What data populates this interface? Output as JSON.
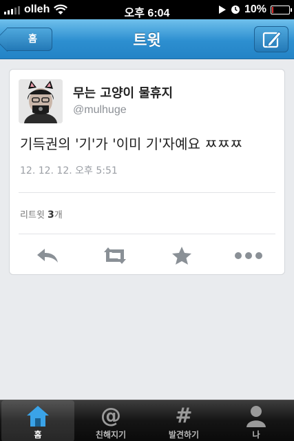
{
  "status_bar": {
    "carrier": "olleh",
    "time": "오후 6:04",
    "battery": "10%",
    "battery_level": 0.1,
    "battery_color": "#e33333"
  },
  "nav": {
    "title": "트윗",
    "back_label": "홈",
    "compose_icon": "compose-icon"
  },
  "tweet": {
    "display_name": "무는 고양이 물휴지",
    "handle": "@mulhuge",
    "text": "기득권의 '기'가 '이미 기'자예요 ㅉㅉㅉ",
    "timestamp": "12. 12. 12. 오후 5:51",
    "retweet_prefix": "리트윗 ",
    "retweet_count": "3",
    "retweet_suffix": "개"
  },
  "actions": [
    {
      "name": "reply-icon"
    },
    {
      "name": "retweet-icon"
    },
    {
      "name": "favorite-star-icon"
    },
    {
      "name": "more-icon"
    }
  ],
  "tabs": [
    {
      "label": "홈",
      "icon": "home-icon",
      "active": true
    },
    {
      "label": "친해지기",
      "icon": "at-icon",
      "glyph": "@",
      "active": false
    },
    {
      "label": "발견하기",
      "icon": "hashtag-icon",
      "glyph": "#",
      "active": false
    },
    {
      "label": "나",
      "icon": "person-icon",
      "active": false
    }
  ],
  "colors": {
    "nav_blue": "#2d8fd0",
    "tab_active_icon": "#3aa3e8"
  }
}
